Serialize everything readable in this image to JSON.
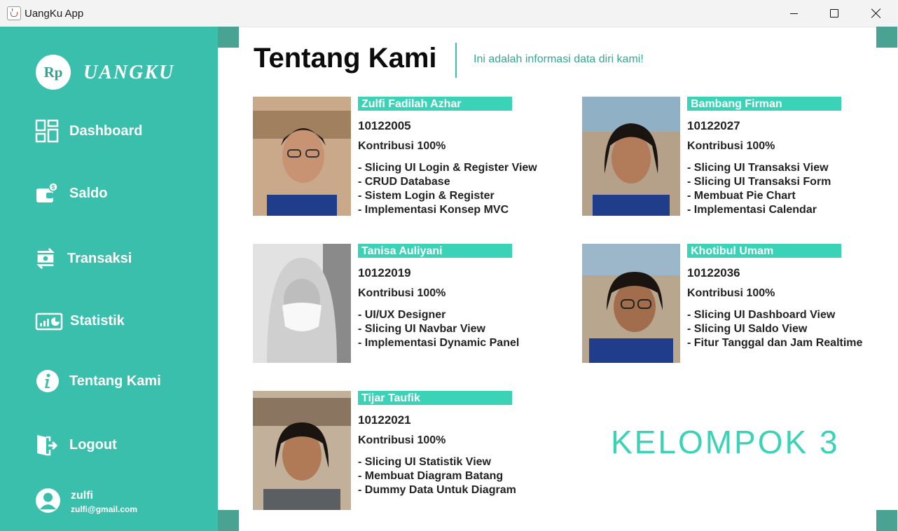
{
  "window": {
    "title": "UangKu App",
    "icon": "java-cup-icon"
  },
  "sidebar": {
    "logo_text": "Rp",
    "brand": "UANGKU",
    "items": [
      {
        "label": "Dashboard",
        "icon": "dashboard-grid-icon"
      },
      {
        "label": "Saldo",
        "icon": "wallet-icon"
      },
      {
        "label": "Transaksi",
        "icon": "transfer-arrows-icon"
      },
      {
        "label": "Statistik",
        "icon": "chart-icon"
      },
      {
        "label": "Tentang Kami",
        "icon": "info-icon"
      },
      {
        "label": "Logout",
        "icon": "logout-icon"
      }
    ],
    "user": {
      "name": "zulfi",
      "email": "zulfi@gmail.com"
    }
  },
  "header": {
    "title": "Tentang Kami",
    "subtitle": "Ini adalah informasi data diri kami!"
  },
  "members": [
    {
      "name": "Zulfi Fadilah Azhar",
      "nim": "10122005",
      "contribution": "Kontribusi 100%",
      "tasks": [
        "- Slicing UI Login & Register View",
        "- CRUD Database",
        "- Sistem Login & Register",
        "- Implementasi Konsep MVC"
      ]
    },
    {
      "name": "Bambang Firman",
      "nim": "10122027",
      "contribution": "Kontribusi 100%",
      "tasks": [
        "- Slicing UI Transaksi View",
        "- Slicing UI Transaksi Form",
        "- Membuat Pie Chart",
        "- Implementasi Calendar"
      ]
    },
    {
      "name": "Tanisa Auliyani",
      "nim": "10122019",
      "contribution": "Kontribusi 100%",
      "tasks": [
        "- UI/UX Designer",
        "- Slicing UI Navbar View",
        "- Implementasi Dynamic Panel"
      ]
    },
    {
      "name": "Khotibul Umam",
      "nim": "10122036",
      "contribution": "Kontribusi 100%",
      "tasks": [
        "- Slicing UI Dashboard View",
        "- Slicing UI Saldo View",
        "- Fitur Tanggal dan Jam Realtime"
      ]
    },
    {
      "name": "Tijar Taufik",
      "nim": "10122021",
      "contribution": "Kontribusi 100%",
      "tasks": [
        "- Slicing UI Statistik View",
        "- Membuat Diagram Batang",
        "- Dummy Data Untuk Diagram"
      ]
    }
  ],
  "group_label": "KELOMPOK 3",
  "colors": {
    "sidebar": "#3bbfad",
    "accent": "#3bd3b7",
    "corner": "#4aa392"
  }
}
